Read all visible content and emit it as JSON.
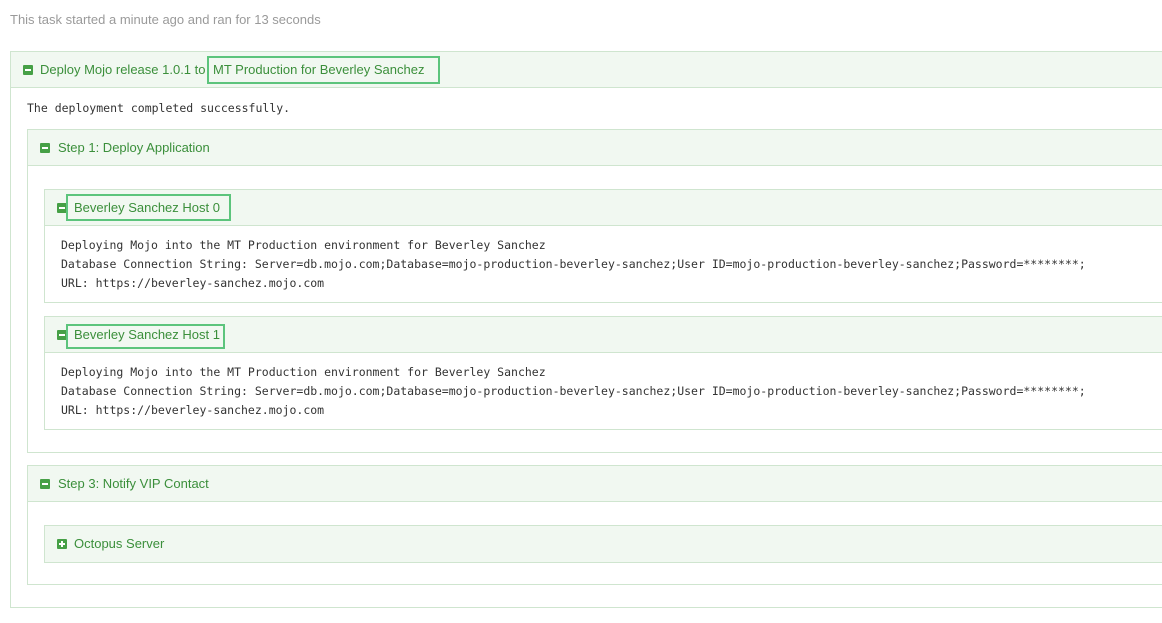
{
  "task_summary": "This task started a minute ago and ran for 13 seconds",
  "deployment": {
    "title_prefix": "Deploy Mojo release 1.0.1 to",
    "title_highlight": "MT Production for Beverley Sanchez",
    "result": "The deployment completed successfully.",
    "toggle_icon": "minus-square-icon"
  },
  "steps": [
    {
      "title": "Step 1: Deploy Application",
      "toggle_icon": "minus-square-icon",
      "hosts": [
        {
          "name": "Beverley Sanchez Host 0",
          "toggle_icon": "minus-square-icon",
          "log": [
            "Deploying Mojo into the MT Production environment for Beverley Sanchez",
            "Database Connection String: Server=db.mojo.com;Database=mojo-production-beverley-sanchez;User ID=mojo-production-beverley-sanchez;Password=********;",
            "URL: https://beverley-sanchez.mojo.com"
          ]
        },
        {
          "name": "Beverley Sanchez Host 1",
          "toggle_icon": "minus-square-icon",
          "log": [
            "Deploying Mojo into the MT Production environment for Beverley Sanchez",
            "Database Connection String: Server=db.mojo.com;Database=mojo-production-beverley-sanchez;User ID=mojo-production-beverley-sanchez;Password=********;",
            "URL: https://beverley-sanchez.mojo.com"
          ]
        }
      ]
    },
    {
      "title": "Step 3: Notify VIP Contact",
      "toggle_icon": "minus-square-icon",
      "hosts": [
        {
          "name": "Octopus Server",
          "toggle_icon": "plus-square-icon",
          "collapsed": true
        }
      ]
    }
  ],
  "colors": {
    "accent": "#3b8f3b",
    "panel_header_bg": "#f1f8f1",
    "panel_border": "#cfe5cf",
    "highlight_border": "#5cc47c"
  }
}
